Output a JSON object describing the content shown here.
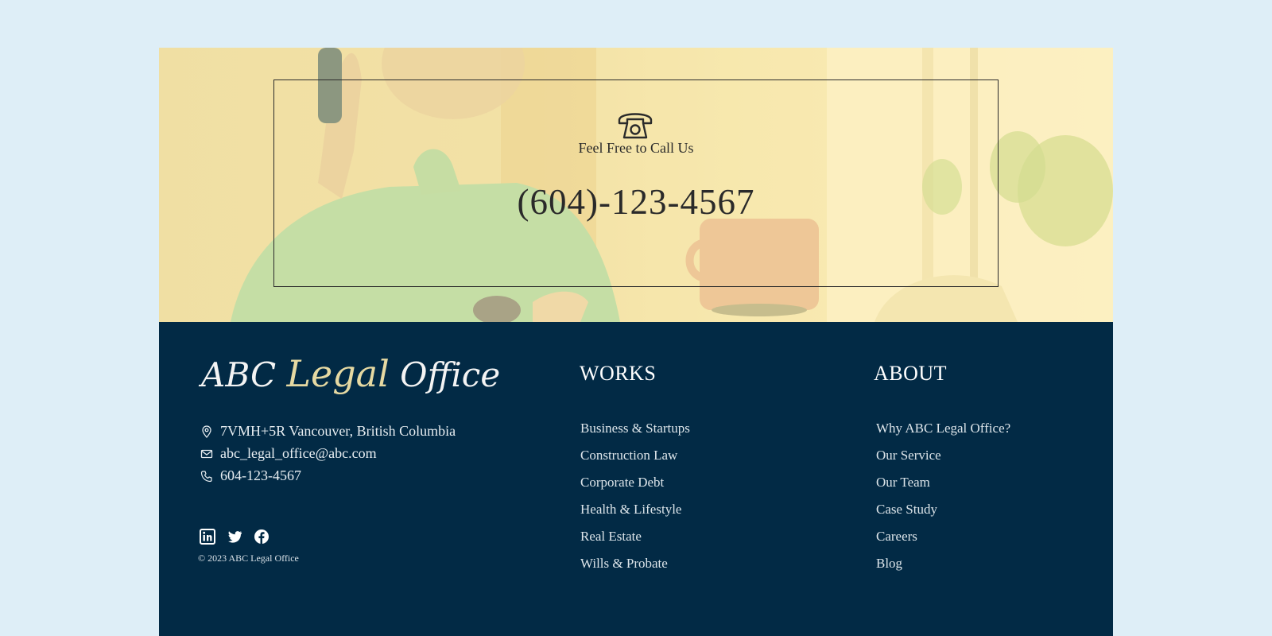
{
  "hero": {
    "call_label": "Feel Free to Call Us",
    "phone_number": "(604)-123-4567",
    "icon": "telephone-icon"
  },
  "footer": {
    "logo": {
      "part1": "ABC ",
      "part2": "Legal",
      "part3": " Office"
    },
    "contact": {
      "address": "7VMH+5R Vancouver, British Columbia",
      "email": "abc_legal_office@abc.com",
      "phone": "604-123-4567"
    },
    "social_icons": [
      "linkedin-icon",
      "twitter-icon",
      "facebook-icon"
    ],
    "copyright": "© 2023 ABC Legal Office",
    "works": {
      "title": "WORKS",
      "items": [
        "Business & Startups",
        "Construction Law",
        "Corporate Debt",
        "Health & Lifestyle",
        "Real Estate",
        "Wills & Probate"
      ]
    },
    "about": {
      "title": "ABOUT",
      "items": [
        "Why ABC Legal Office?",
        "Our Service",
        "Our Team",
        "Case Study",
        "Careers",
        "Blog"
      ]
    }
  },
  "colors": {
    "page_background": "#deeef7",
    "footer_background": "#022a45",
    "hero_overlay": "#f3e6b0",
    "logo_accent": "#e6d9a2"
  }
}
